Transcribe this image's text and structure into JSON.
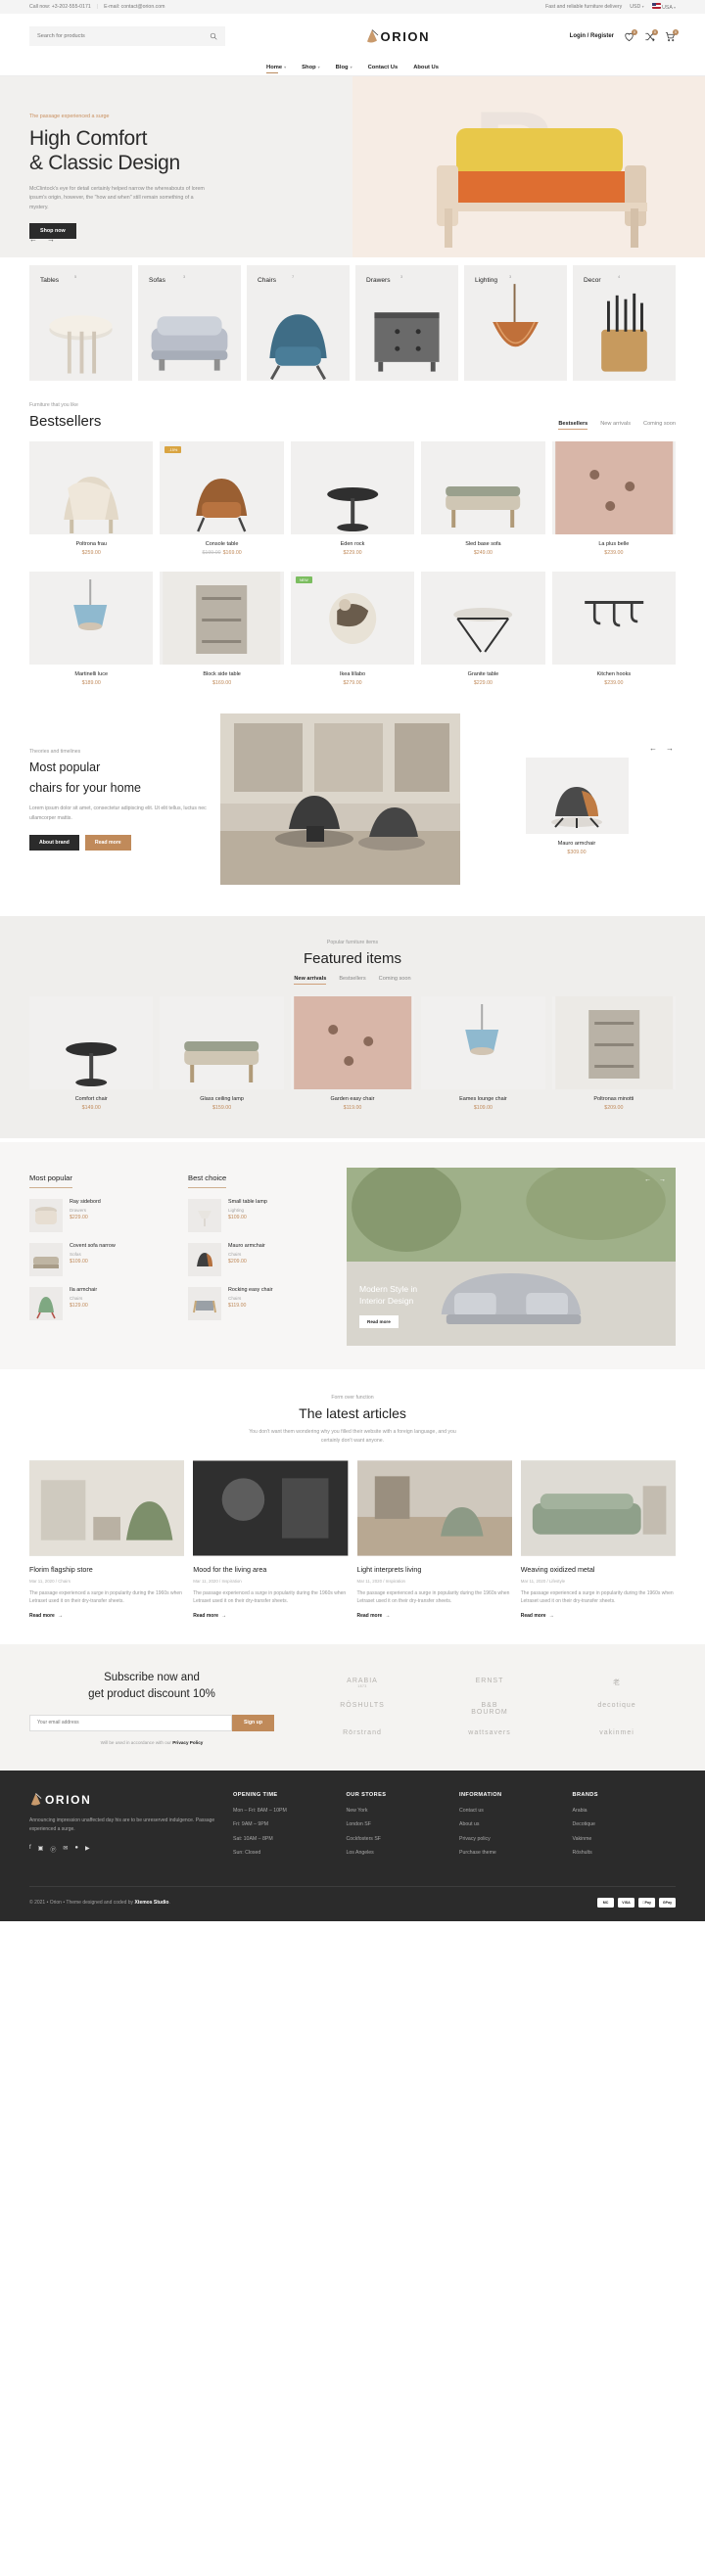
{
  "topbar": {
    "phone": "Call now: +3-202-555-0171",
    "separator": "|",
    "email": "E-mail: contact@orion.com",
    "delivery": "Fast and reliable furniture delivery",
    "currency": "USD",
    "country": "USA"
  },
  "header": {
    "search_placeholder": "Search for products",
    "logo": "ORION",
    "login": "Login / Register",
    "wishlist_count": "0",
    "compare_count": "0",
    "cart_count": "0"
  },
  "nav": [
    {
      "label": "Home",
      "caret": true,
      "active": true
    },
    {
      "label": "Shop",
      "caret": true,
      "active": false
    },
    {
      "label": "Blog",
      "caret": true,
      "active": false
    },
    {
      "label": "Contact Us",
      "caret": false,
      "active": false
    },
    {
      "label": "About Us",
      "caret": false,
      "active": false
    }
  ],
  "hero": {
    "eyebrow": "The passage experienced a surge",
    "title_line1": "High Comfort",
    "title_line2": "& Classic Design",
    "paragraph": "McClintock's eye for detail certainly helped narrow the whereabouts of lorem ipsum's origin, however, the \"how and when\" still remain something of a mystery.",
    "button": "Shop now",
    "bg_letter": "B",
    "prev": "←",
    "next": "→"
  },
  "categories": [
    {
      "label": "Tables",
      "count": "5"
    },
    {
      "label": "Sofas",
      "count": "3"
    },
    {
      "label": "Chairs",
      "count": "7"
    },
    {
      "label": "Drawers",
      "count": "3"
    },
    {
      "label": "Lighting",
      "count": "3"
    },
    {
      "label": "Decor",
      "count": "4"
    }
  ],
  "bestsellers": {
    "eyebrow": "Furniture that you like",
    "title": "Bestsellers",
    "tabs": [
      {
        "label": "Bestsellers",
        "active": true
      },
      {
        "label": "New arrivals",
        "active": false
      },
      {
        "label": "Coming soon",
        "active": false
      }
    ],
    "row1": [
      {
        "name": "Poltrona frau",
        "price": "$259.00",
        "old": "",
        "tag": ""
      },
      {
        "name": "Console table",
        "price": "$169.00",
        "old": "$199.00",
        "tag": "-15%"
      },
      {
        "name": "Eden rock",
        "price": "$229.00",
        "old": "",
        "tag": ""
      },
      {
        "name": "Sled base sofa",
        "price": "$249.00",
        "old": "",
        "tag": ""
      },
      {
        "name": "La plus belle",
        "price": "$239.00",
        "old": "",
        "tag": ""
      }
    ],
    "row2": [
      {
        "name": "Martinelli luce",
        "price": "$189.00",
        "old": "",
        "tag": ""
      },
      {
        "name": "Block side table",
        "price": "$169.00",
        "old": "",
        "tag": ""
      },
      {
        "name": "Ikea lillabo",
        "price": "$279.00",
        "old": "",
        "tag": "NEW"
      },
      {
        "name": "Granite table",
        "price": "$229.00",
        "old": "",
        "tag": ""
      },
      {
        "name": "Kitchen hooks",
        "price": "$239.00",
        "old": "",
        "tag": ""
      }
    ]
  },
  "promo": {
    "eyebrow": "Theories and timelines",
    "title_line1": "Most popular",
    "title_line2": "chairs for your home",
    "paragraph": "Lorem ipsum dolor sit amet, consectetur adipiscing elit. Ut elit tellus, luctus nec ullamcorper mattis.",
    "btn_dark": "About brand",
    "btn_tan": "Read more",
    "card_name": "Mauro armchair",
    "card_price": "$309.00",
    "prev": "←",
    "next": "→"
  },
  "featured": {
    "eyebrow": "Popular furniture items",
    "title": "Featured items",
    "tabs": [
      {
        "label": "New arrivals",
        "active": true
      },
      {
        "label": "Bestsellers",
        "active": false
      },
      {
        "label": "Coming soon",
        "active": false
      }
    ],
    "items": [
      {
        "name": "Comfort chair",
        "price": "$149.00"
      },
      {
        "name": "Glass ceiling lamp",
        "price": "$159.00"
      },
      {
        "name": "Garden easy chair",
        "price": "$119.00"
      },
      {
        "name": "Eames lounge chair",
        "price": "$109.00"
      },
      {
        "name": "Poltronas minotti",
        "price": "$209.00"
      }
    ]
  },
  "lists": {
    "most_popular": {
      "title": "Most popular",
      "items": [
        {
          "name": "Ray sidebord",
          "cat": "Drawers",
          "price": "$229.00"
        },
        {
          "name": "Covent sofa narrow",
          "cat": "Sofas",
          "price": "$109.00"
        },
        {
          "name": "Ila armchair",
          "cat": "Chairs",
          "price": "$129.00"
        }
      ]
    },
    "best_choice": {
      "title": "Best choice",
      "items": [
        {
          "name": "Small table lamp",
          "cat": "Lighting",
          "price": "$109.00"
        },
        {
          "name": "Mauro armchair",
          "cat": "Chairs",
          "price": "$209.00"
        },
        {
          "name": "Rocking easy chair",
          "cat": "Chairs",
          "price": "$119.00"
        }
      ]
    },
    "banner": {
      "line1": "Modern Style in",
      "line2": "Interior Design",
      "button": "Read more",
      "prev": "←",
      "next": "→"
    }
  },
  "articles": {
    "eyebrow": "Form over function",
    "title": "The latest articles",
    "subtitle": "You don't want them wondering why you filled their website with a foreign language, and you certainly don't want anyone.",
    "items": [
      {
        "title": "Florim flagship store",
        "meta": "Mar 11, 2020  /  Chairs",
        "excerpt": "The passage experienced a surge in popularity during the 1960s when Letraset used it on their dry-transfer sheets.",
        "more": "Read more"
      },
      {
        "title": "Mood for the living area",
        "meta": "Mar 11, 2020  /  Inspiration",
        "excerpt": "The passage experienced a surge in popularity during the 1960s when Letraset used it on their dry-transfer sheets.",
        "more": "Read more"
      },
      {
        "title": "Light interprets living",
        "meta": "Mar 11, 2020  /  Inspiration",
        "excerpt": "The passage experienced a surge in popularity during the 1960s when Letraset used it on their dry-transfer sheets.",
        "more": "Read more"
      },
      {
        "title": "Weaving oxidized metal",
        "meta": "Mar 11, 2020  /  Lifestyle",
        "excerpt": "The passage experienced a surge in popularity during the 1960s when Letraset used it on their dry-transfer sheets.",
        "more": "Read more"
      }
    ]
  },
  "newsletter": {
    "title_line1": "Subscribe now and",
    "title_line2": "get product discount 10%",
    "placeholder": "Your email address",
    "button": "Sign up",
    "note_pre": "Will be used in accordance with our ",
    "note_link": "Privacy Policy",
    "brands": [
      {
        "name": "ARABIA",
        "sub": "1873"
      },
      {
        "name": "ERNST",
        "sub": ""
      },
      {
        "name": "老",
        "sub": ""
      },
      {
        "name": "RÖSHULTS",
        "sub": ""
      },
      {
        "name": "B&B\nBOUROM",
        "sub": ""
      },
      {
        "name": "decotique",
        "sub": ""
      },
      {
        "name": "Rörstrand",
        "sub": ""
      },
      {
        "name": "wattsavers",
        "sub": ""
      },
      {
        "name": "vakinmei",
        "sub": ""
      }
    ]
  },
  "footer": {
    "logo": "ORION",
    "description": "Announcing impression unaffected day his are to be unreserved indulgence. Passage experienced a surge.",
    "social": [
      "f",
      "▣",
      "ⓟ",
      "✉",
      "●",
      "▶"
    ],
    "columns": [
      {
        "title": "OPENING TIME",
        "links": [
          "Mon – Fri: 8AM – 10PM",
          "Fri: 9AM – 9PM",
          "Sat: 10AM – 8PM",
          "Sun: Closed"
        ]
      },
      {
        "title": "OUR STORES",
        "links": [
          "New York",
          "London SF",
          "Cockfosters SF",
          "Los Angeles"
        ]
      },
      {
        "title": "INFORMATION",
        "links": [
          "Contact us",
          "About us",
          "Privacy policy",
          "Purchase theme"
        ]
      },
      {
        "title": "BRANDS",
        "links": [
          "Arabia",
          "Decotique",
          "Vakinme",
          "Röshults"
        ]
      }
    ],
    "copyright_pre": "© 2021 • Orion • Theme designed and coded by ",
    "copyright_brand": "Xtemos Studio",
    "copyright_post": ".",
    "payments": [
      "MC",
      "VISA",
      "Pay",
      "GPay"
    ]
  },
  "colors": {
    "accent": "#c08a5a",
    "dark": "#2b2b2b",
    "light_bg": "#f1f0ee"
  }
}
